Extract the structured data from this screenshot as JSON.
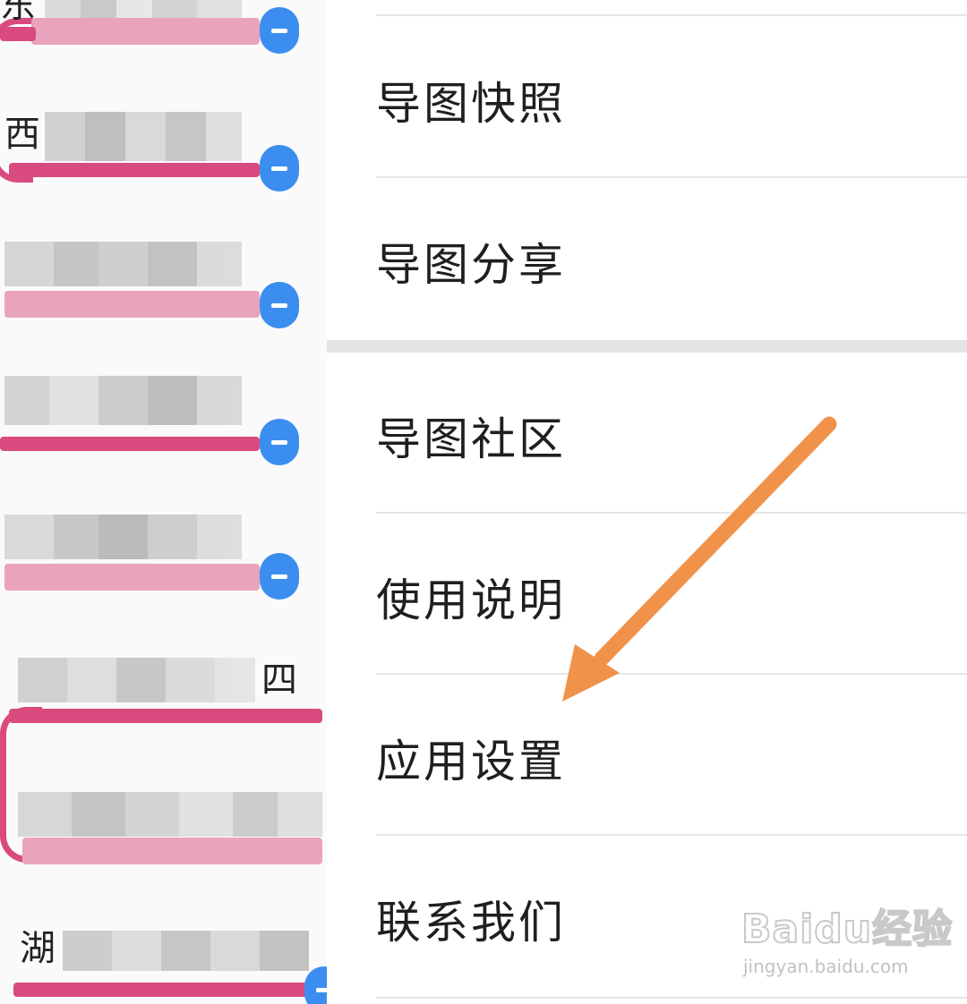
{
  "menu": {
    "items": [
      {
        "label": "导图快照"
      },
      {
        "label": "导图分享"
      },
      {
        "label": "导图社区"
      },
      {
        "label": "使用说明"
      },
      {
        "label": "应用设置"
      },
      {
        "label": "联系我们"
      }
    ]
  },
  "mindmap": {
    "visible_glyphs": [
      "东",
      "西",
      "四",
      "湖"
    ]
  },
  "annotation": {
    "arrow_color": "#f0924a",
    "points_to": "应用设置"
  },
  "watermark": {
    "brand": "Baidu经验",
    "site": "jingyan.baidu.com"
  },
  "colors": {
    "branch_pink": "#d94b7f",
    "node_blue": "#3b8ef0",
    "divider": "#e6e6e6"
  }
}
